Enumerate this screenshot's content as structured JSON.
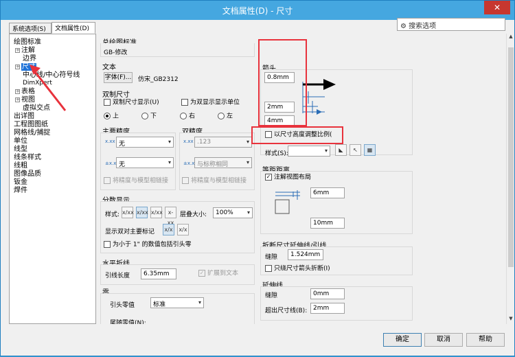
{
  "window": {
    "title": "文档属性(D) - 尺寸",
    "close": "✕"
  },
  "tabs": [
    {
      "label": "系统选项(S)"
    },
    {
      "label": "文档属性(D)"
    }
  ],
  "search": {
    "placeholder": "搜索选项"
  },
  "tree": [
    {
      "label": "绘图标准",
      "expander": ""
    },
    {
      "label": "注解",
      "expander": "+"
    },
    {
      "label": "边界",
      "expander": ""
    },
    {
      "label": "尺寸",
      "expander": "+"
    },
    {
      "label": "中心线/中心符号线",
      "expander": ""
    },
    {
      "label": "DimXpert",
      "expander": ""
    },
    {
      "label": "表格",
      "expander": "+"
    },
    {
      "label": "视图",
      "expander": "+"
    },
    {
      "label": "虚拟交点",
      "expander": ""
    },
    {
      "label": "出详图",
      "expander": ""
    },
    {
      "label": "工程图图纸",
      "expander": ""
    },
    {
      "label": "网格线/捕捉",
      "expander": ""
    },
    {
      "label": "单位",
      "expander": ""
    },
    {
      "label": "线型",
      "expander": ""
    },
    {
      "label": "线条样式",
      "expander": ""
    },
    {
      "label": "线粗",
      "expander": ""
    },
    {
      "label": "图像品质",
      "expander": ""
    },
    {
      "label": "钣金",
      "expander": ""
    },
    {
      "label": "焊件",
      "expander": ""
    }
  ],
  "overall_standard": {
    "title": "总绘图标准",
    "value": "GB-修改"
  },
  "text": {
    "title": "文本",
    "font_button": "字体(F)...",
    "font_value": "仿宋_GB2312"
  },
  "dual": {
    "title": "双制尺寸",
    "show_dual": "双制尺寸显示(U)",
    "show_units": "为双显示显示单位",
    "pos_top": "上",
    "pos_bottom": "下",
    "pos_right": "右",
    "pos_left": "左"
  },
  "primary_precision": {
    "title": "主要精度",
    "value1": "无",
    "value2": "无",
    "link": "将精度与模型相链接",
    "icon1": "x.xx",
    "icon2": "±x.xx"
  },
  "dual_precision": {
    "title": "双精度",
    "value1": ".123",
    "value2": "与标称相同",
    "link": "将精度与模型相链接",
    "icon1": "x.xx",
    "icon2": "±x.xx"
  },
  "fraction": {
    "title": "分数显示",
    "style_label": "样式:",
    "stack_label": "层叠大小:",
    "stack_value": "100%",
    "show_dual_label": "显示双对主要标记",
    "below_one": "为小于 1\" 的数值包括引头零",
    "btn1": "x/xx",
    "btn2": "x/xx",
    "btn3": "x/xx",
    "btn4": "x-xx",
    "btn5": "x/x",
    "btn6": "x/x"
  },
  "leader": {
    "title": "水平折线",
    "length_label": "引线长度",
    "length_value": "6.35mm",
    "extend": "扩展到文本"
  },
  "zeros": {
    "title": "零",
    "leading_label": "引头零值",
    "leading_value": "标准",
    "trailing_label": "尾随零值(N):"
  },
  "arrows": {
    "title": "箭头",
    "size1": "0.8mm",
    "size2": "2mm",
    "size3": "4mm",
    "scale": "以尺寸高度调整比例(",
    "style_label": "样式(S):",
    "icon1": "◣",
    "icon2": "↖",
    "icon3": "▦"
  },
  "offset": {
    "title": "等距距离",
    "from_label": "注解视图布局",
    "value1": "6mm",
    "value2": "10mm"
  },
  "break": {
    "title": "折断尺寸延伸线/引线",
    "gap_label": "缝隙",
    "gap_value": "1.524mm",
    "only_arrow": "只绕尺寸箭头折断(I)"
  },
  "extension": {
    "title": "延伸线",
    "gap_label": "缝隙",
    "gap_value": "0mm",
    "beyond_label": "超出尺寸线(B):",
    "beyond_value": "2mm"
  },
  "footer": {
    "ok": "确定",
    "cancel": "取消",
    "help": "帮助"
  },
  "colors": {
    "accent": "#45a7e0",
    "annotation": "#e8323c",
    "selected": "#1e72d8"
  }
}
